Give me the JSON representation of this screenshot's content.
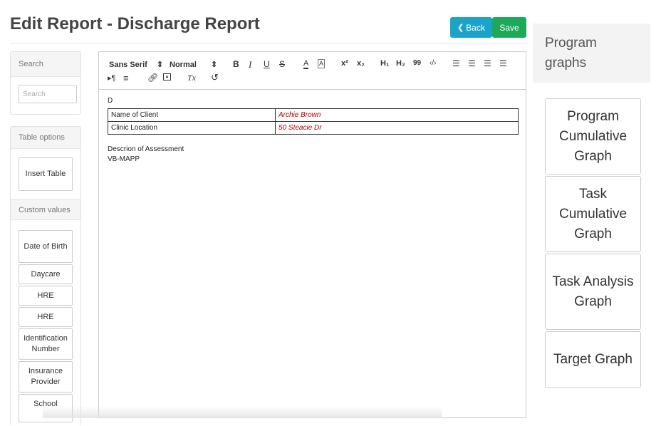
{
  "header": {
    "title": "Edit Report - Discharge Report",
    "back_label": "Back",
    "save_label": "Save"
  },
  "left": {
    "search_header": "Search",
    "search_placeholder": "Search",
    "table_options_header": "Table options",
    "insert_table_label": "Insert Table",
    "custom_values_header": "Custom values",
    "custom_values": [
      "Date of Birth",
      "Daycare",
      "HRE",
      "HRE",
      "Identification Number",
      "Insurance Provider",
      "School"
    ]
  },
  "toolbar": {
    "font": "Sans Serif",
    "size": "Normal",
    "bold": "B",
    "italic": "I",
    "underline": "U",
    "strike": "S",
    "color": "A",
    "background": "A",
    "superscript": "x²",
    "subscript": "x₂",
    "h1": "H₁",
    "h2": "H₂",
    "blockquote": "99",
    "code": "‹/›",
    "direction": "▸¶",
    "align": "≡",
    "clean": "Tx",
    "undo": "↺"
  },
  "document": {
    "first_line": "D",
    "table": [
      {
        "label": "Name of Client",
        "value": "Archie Brown"
      },
      {
        "label": "Clinic Location",
        "value": "50 Steacie Dr"
      }
    ],
    "lines": [
      "Descrion of Assessment",
      "VB-MAPP"
    ]
  },
  "right": {
    "header": "Program graphs",
    "graphs": [
      "Program Cumulative Graph",
      "Task Cumulative Graph",
      "Task Analysis Graph",
      "Target Graph"
    ]
  },
  "colors": {
    "back": "#1ba4c8",
    "save": "#1da85a",
    "value_text": "#b00000"
  }
}
